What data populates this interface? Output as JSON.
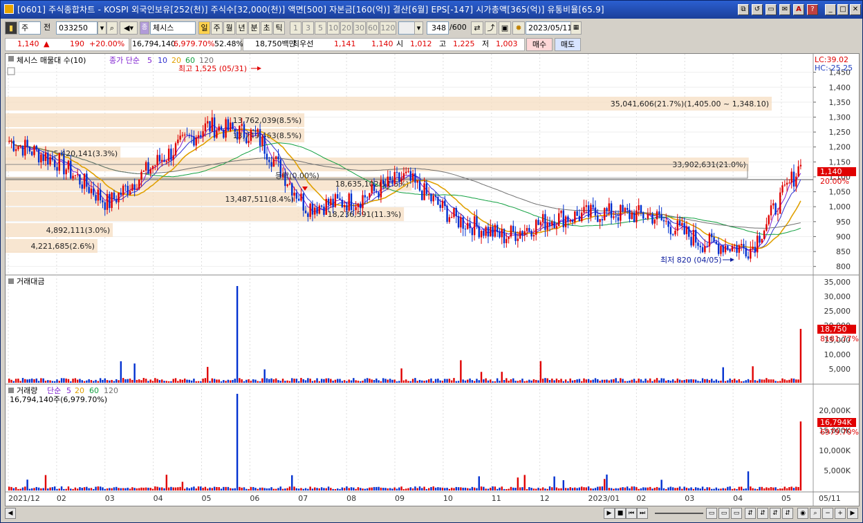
{
  "window": {
    "title": "[0601] 주식종합차트 - KOSPI 외국인보유[252(천)] 주식수[32,000(천)] 액면[500] 자본금[160(억)] 결산[6월] EPS[-147] 시가총액[365(억)] 유통비율[65.9]",
    "buttons": [
      "⧉",
      "↺",
      "▭",
      "✉",
      "A",
      "?",
      "_",
      "□",
      "✕"
    ]
  },
  "toolbar": {
    "mode": "주",
    "prefix_label": "전",
    "code": "033250",
    "name": "체시스",
    "periods": [
      "일",
      "주",
      "월",
      "년",
      "분",
      "초",
      "틱"
    ],
    "active_period": "일",
    "intervals": [
      "1",
      "3",
      "5",
      "10",
      "20",
      "30",
      "60",
      "120"
    ],
    "count": "348",
    "count_total": "/600",
    "date": "2023/05/11"
  },
  "quote": {
    "price": "1,140",
    "arrow": "▲",
    "change": "190",
    "change_pct": "+20.00%",
    "volume": "16,794,140",
    "volume_pct": "6,979.70%",
    "ratio": "52.48%",
    "trade_value": "18,750백만",
    "best_label": "최우선",
    "best_ask": "1,141",
    "best_bid": "1,140",
    "open_label": "시",
    "open": "1,012",
    "high_label": "고",
    "high": "1,225",
    "low_label": "저",
    "low": "1,003",
    "buy_label": "매수",
    "sell_label": "매도"
  },
  "price_panel": {
    "title": "체시스 매물대 수(10)",
    "ma_label": "종가 단순",
    "ma_periods": [
      "5",
      "10",
      "20",
      "60",
      "120"
    ],
    "ma_colors": [
      "#7f1fd0",
      "#3030d0",
      "#e0a000",
      "#11a040",
      "#707070"
    ],
    "lc": "LC:39.02",
    "hc": "HC:-25.25",
    "high_note": "최고 1,525 (05/31)",
    "low_note": "최저 820 (04/05)",
    "last_price": "1,140",
    "last_pct": "20.00%",
    "profile": [
      {
        "label": "35,041,606(21.7%)(1,405.00 ~ 1,348.10)",
        "width": 1.0
      },
      {
        "label": "13,762,039(8.5%)",
        "width": 0.39
      },
      {
        "label": "13,749,463(8.5%)",
        "width": 0.39
      },
      {
        "label": "5,420,141(3.3%)",
        "width": 0.15
      },
      {
        "label": "33,902,631(21.0%)",
        "width": 0.97
      },
      {
        "label": "18,635,102(11.5%)",
        "width": 0.53
      },
      {
        "label": "13,487,511(8.4%)",
        "width": 0.38
      },
      {
        "label": "18,236,591(11.3%)",
        "width": 0.52
      },
      {
        "label": "4,892,111(3.0%)",
        "width": 0.14
      },
      {
        "label": "4,221,685(2.6%)",
        "width": 0.12
      }
    ],
    "mid_label": "등락(0.00%)",
    "yticks": [
      "1,450",
      "1,400",
      "1,350",
      "1,300",
      "1,250",
      "1,200",
      "1,150",
      "1,100",
      "1,050",
      "1,000",
      "950",
      "900",
      "850",
      "800"
    ]
  },
  "value_panel": {
    "title": "거래대금",
    "last": "18,750",
    "last_pct": "8181.77%",
    "yticks": [
      "35,000",
      "30,000",
      "25,000",
      "20,000",
      "15,000",
      "10,000",
      "5,000"
    ]
  },
  "volume_panel": {
    "title": "거래량",
    "ma_label": "단순",
    "ma_periods": [
      "5",
      "20",
      "60",
      "120"
    ],
    "ma_colors": [
      "#7f1fd0",
      "#e0a000",
      "#11a040",
      "#707070"
    ],
    "info": "16,794,140주(6,979.70%)",
    "last": "16,794K",
    "last_pct": "6979.70%",
    "yticks": [
      "20,000K",
      "15,000K",
      "10,000K",
      "5,000K"
    ]
  },
  "xaxis": [
    "2021/12",
    "02",
    "03",
    "04",
    "05",
    "06",
    "07",
    "08",
    "09",
    "10",
    "11",
    "12",
    "2023/01",
    "02",
    "03",
    "04",
    "05",
    "05/11"
  ],
  "chart_data": {
    "type": "candlestick",
    "x": [
      "2021/12",
      "02",
      "03",
      "04",
      "05",
      "06",
      "07",
      "08",
      "09",
      "10",
      "11",
      "12",
      "2023/01",
      "02",
      "03",
      "04",
      "05"
    ],
    "approx_close": [
      1220,
      1150,
      1010,
      1150,
      1270,
      1240,
      1000,
      1020,
      1100,
      960,
      900,
      960,
      980,
      970,
      880,
      860,
      1140
    ],
    "high": {
      "value": 1525,
      "date": "05/31"
    },
    "low": {
      "value": 820,
      "date": "04/05"
    },
    "ylim": [
      790,
      1470
    ],
    "last": 1140
  }
}
